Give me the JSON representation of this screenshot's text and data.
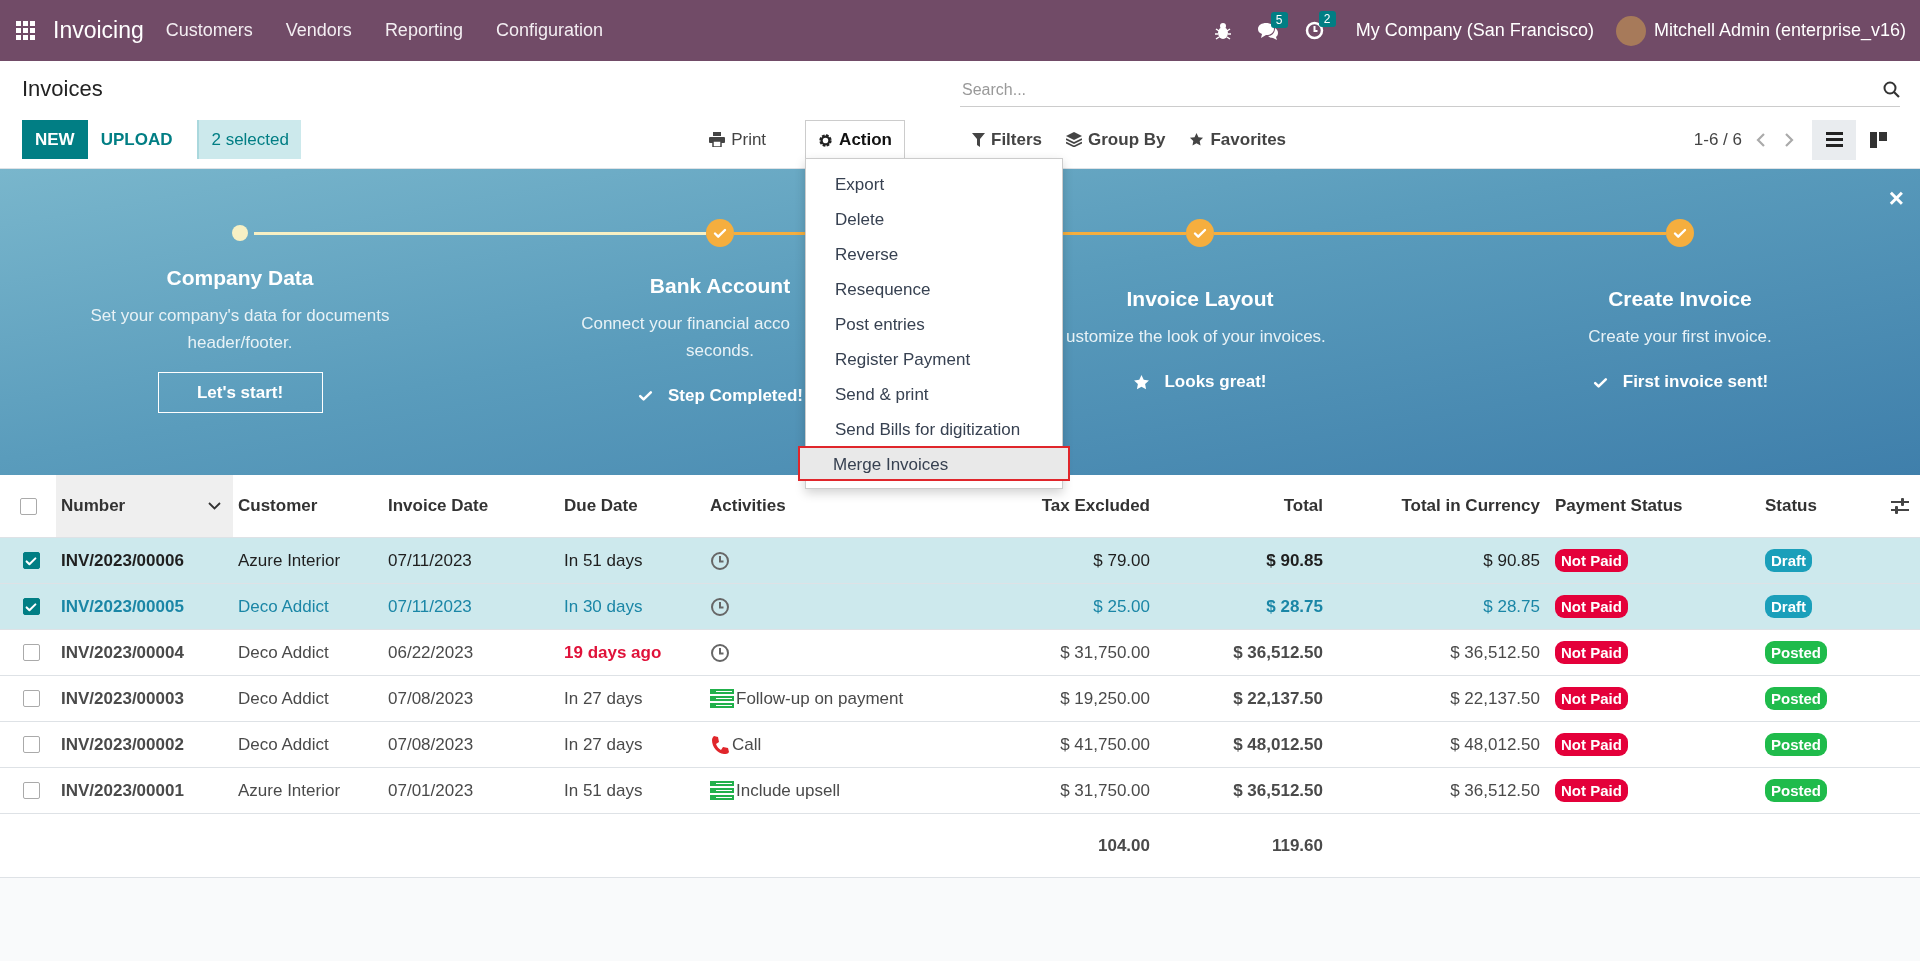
{
  "navbar": {
    "app_name": "Invoicing",
    "menu": [
      "Customers",
      "Vendors",
      "Reporting",
      "Configuration"
    ],
    "messages_count": "5",
    "activities_count": "2",
    "company": "My Company (San Francisco)",
    "user": "Mitchell Admin (enterprise_v16)"
  },
  "control_panel": {
    "title": "Invoices",
    "search": {
      "placeholder": "Search..."
    },
    "buttons": [
      {
        "label": "NEW",
        "kind": "primary"
      },
      {
        "label": "UPLOAD",
        "kind": "link"
      }
    ],
    "selection": "2 selected",
    "actions": [
      {
        "label": "Print",
        "kind": "print",
        "expanded": false
      },
      {
        "label": "Action",
        "kind": "gear",
        "expanded": true
      }
    ],
    "filters": [
      {
        "label": "Filters",
        "kind": "filter"
      },
      {
        "label": "Group By",
        "kind": "layers"
      },
      {
        "label": "Favorites",
        "kind": "star"
      }
    ],
    "pager": "1-6 / 6",
    "views": [
      {
        "kind": "list",
        "selected": true
      },
      {
        "kind": "kanban",
        "selected": false
      }
    ]
  },
  "action_menu": {
    "items": [
      {
        "label": "Export",
        "selected": false
      },
      {
        "label": "Delete",
        "selected": false
      },
      {
        "label": "Reverse",
        "selected": false
      },
      {
        "label": "Resequence",
        "selected": false
      },
      {
        "label": "Post entries",
        "selected": false
      },
      {
        "label": "Register Payment",
        "selected": false
      },
      {
        "label": "Send & print",
        "selected": false
      },
      {
        "label": "Send Bills for digitization",
        "selected": false
      },
      {
        "label": "Merge Invoices",
        "selected": true
      }
    ]
  },
  "banner": {
    "close_label": "×",
    "steps": [
      {
        "title": "Company Data",
        "description": [
          "Set your company's data for documents",
          "header/footer."
        ],
        "done": false,
        "action": {
          "kind": "button",
          "label": "Let's start!"
        }
      },
      {
        "title": "Bank Account",
        "description": [
          "Connect your financial acco",
          "seconds."
        ],
        "done": true,
        "action": {
          "kind": "check",
          "label": "Step Completed!"
        }
      },
      {
        "title": "Invoice Layout",
        "description": [
          "ustomize the look of your invoices."
        ],
        "done": true,
        "action": {
          "kind": "star",
          "label": "Looks great!"
        }
      },
      {
        "title": "Create Invoice",
        "description": [
          "Create your first invoice."
        ],
        "done": true,
        "action": {
          "kind": "check",
          "label": "First invoice sent!"
        }
      }
    ]
  },
  "table": {
    "all_selected": false,
    "columns": [
      {
        "label": "Number",
        "sorted": true
      },
      {
        "label": "Customer",
        "sorted": false
      },
      {
        "label": "Invoice Date",
        "sorted": false
      },
      {
        "label": "Due Date",
        "sorted": false
      },
      {
        "label": "Activities",
        "sorted": false
      },
      {
        "label": "Tax Excluded",
        "sorted": false
      },
      {
        "label": "Total",
        "sorted": false
      },
      {
        "label": "Total in Currency",
        "sorted": false
      },
      {
        "label": "Payment Status",
        "sorted": false
      },
      {
        "label": "Status",
        "sorted": false
      }
    ],
    "rows": [
      {
        "selected": true,
        "highlighted": false,
        "number": "INV/2023/00006",
        "customer": "Azure Interior",
        "invoice_date": "07/11/2023",
        "due_date": "In 51 days",
        "overdue": false,
        "activity": {
          "kind": "clock"
        },
        "tax_excluded": "$ 79.00",
        "total": "$ 90.85",
        "total_in_currency": "$ 90.85",
        "payment_status": {
          "label": "Not Paid",
          "color": "#e4003a"
        },
        "status": {
          "label": "Draft",
          "color": "#1a9fba"
        }
      },
      {
        "selected": true,
        "highlighted": true,
        "number": "INV/2023/00005",
        "customer": "Deco Addict",
        "invoice_date": "07/11/2023",
        "due_date": "In 30 days",
        "overdue": false,
        "activity": {
          "kind": "clock"
        },
        "tax_excluded": "$ 25.00",
        "total": "$ 28.75",
        "total_in_currency": "$ 28.75",
        "payment_status": {
          "label": "Not Paid",
          "color": "#e4003a"
        },
        "status": {
          "label": "Draft",
          "color": "#1a9fba"
        }
      },
      {
        "selected": false,
        "highlighted": false,
        "number": "INV/2023/00004",
        "customer": "Deco Addict",
        "invoice_date": "06/22/2023",
        "due_date": "19 days ago",
        "overdue": true,
        "activity": {
          "kind": "clock"
        },
        "tax_excluded": "$ 31,750.00",
        "total": "$ 36,512.50",
        "total_in_currency": "$ 36,512.50",
        "payment_status": {
          "label": "Not Paid",
          "color": "#e4003a"
        },
        "status": {
          "label": "Posted",
          "color": "#1fbb4b"
        }
      },
      {
        "selected": false,
        "highlighted": false,
        "number": "INV/2023/00003",
        "customer": "Deco Addict",
        "invoice_date": "07/08/2023",
        "due_date": "In 27 days",
        "overdue": false,
        "activity": {
          "kind": "list",
          "label": "Follow-up on payment"
        },
        "tax_excluded": "$ 19,250.00",
        "total": "$ 22,137.50",
        "total_in_currency": "$ 22,137.50",
        "payment_status": {
          "label": "Not Paid",
          "color": "#e4003a"
        },
        "status": {
          "label": "Posted",
          "color": "#1fbb4b"
        }
      },
      {
        "selected": false,
        "highlighted": false,
        "number": "INV/2023/00002",
        "customer": "Deco Addict",
        "invoice_date": "07/08/2023",
        "due_date": "In 27 days",
        "overdue": false,
        "activity": {
          "kind": "phone",
          "label": "Call"
        },
        "tax_excluded": "$ 41,750.00",
        "total": "$ 48,012.50",
        "total_in_currency": "$ 48,012.50",
        "payment_status": {
          "label": "Not Paid",
          "color": "#e4003a"
        },
        "status": {
          "label": "Posted",
          "color": "#1fbb4b"
        }
      },
      {
        "selected": false,
        "highlighted": false,
        "number": "INV/2023/00001",
        "customer": "Azure Interior",
        "invoice_date": "07/01/2023",
        "due_date": "In 51 days",
        "overdue": false,
        "activity": {
          "kind": "list",
          "label": "Include upsell"
        },
        "tax_excluded": "$ 31,750.00",
        "total": "$ 36,512.50",
        "total_in_currency": "$ 36,512.50",
        "payment_status": {
          "label": "Not Paid",
          "color": "#e4003a"
        },
        "status": {
          "label": "Posted",
          "color": "#1fbb4b"
        }
      }
    ],
    "totals": {
      "tax_excluded": "104.00",
      "total": "119.60"
    }
  }
}
